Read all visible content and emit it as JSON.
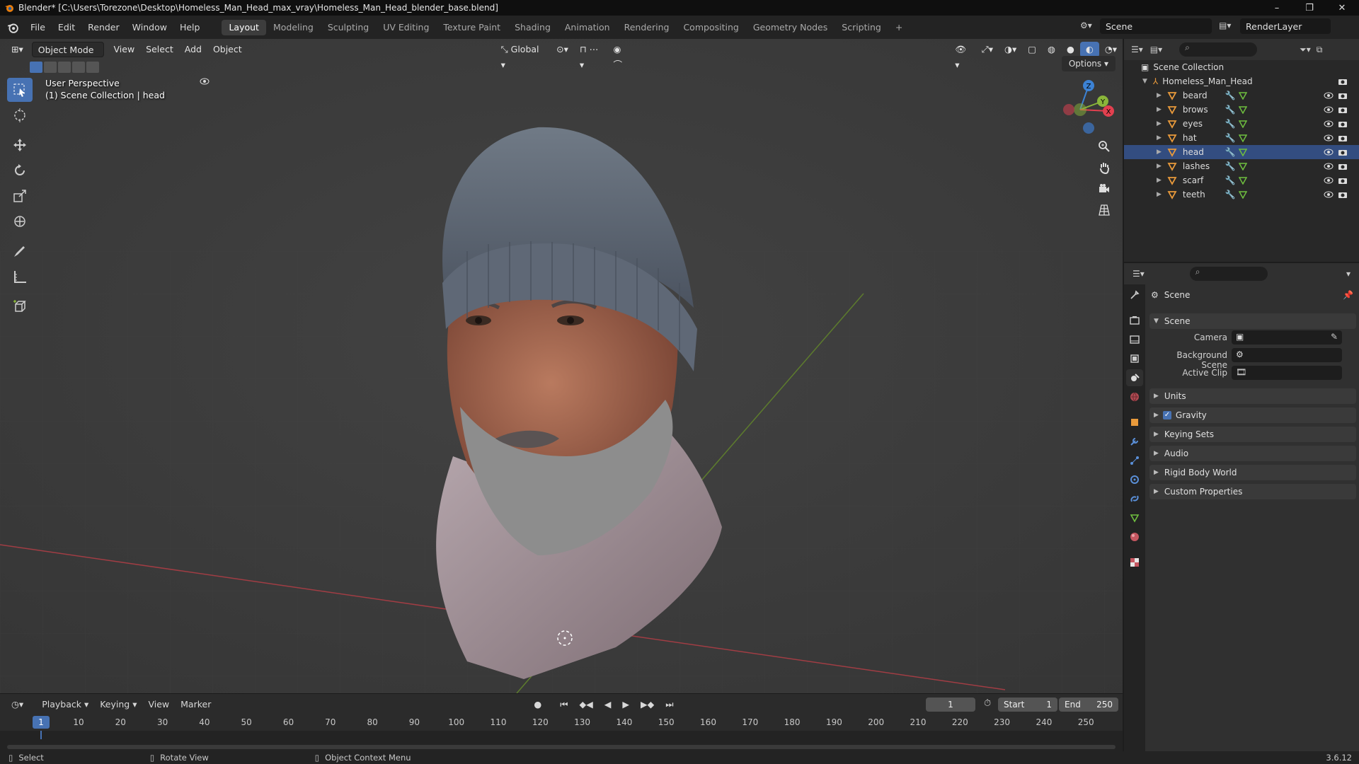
{
  "titlebar": {
    "title": "Blender* [C:\\Users\\Torezone\\Desktop\\Homeless_Man_Head_max_vray\\Homeless_Man_Head_blender_base.blend]",
    "minimize": "–",
    "maximize": "❐",
    "close": "✕"
  },
  "menu": {
    "items": [
      "File",
      "Edit",
      "Render",
      "Window",
      "Help"
    ],
    "workspaces": [
      "Layout",
      "Modeling",
      "Sculpting",
      "UV Editing",
      "Texture Paint",
      "Shading",
      "Animation",
      "Rendering",
      "Compositing",
      "Geometry Nodes",
      "Scripting"
    ],
    "active_workspace": "Layout",
    "add_tab": "+",
    "scene": "Scene",
    "view_layer": "RenderLayer"
  },
  "viewport": {
    "mode": "Object Mode",
    "menus": [
      "View",
      "Select",
      "Add",
      "Object"
    ],
    "orientation": "Global",
    "options": "Options",
    "perspective_label": "User Perspective",
    "collection_label": "(1) Scene Collection | head",
    "axis_labels": {
      "x": "X",
      "y": "Y",
      "z": "Z"
    }
  },
  "timeline": {
    "menus": [
      "Playback",
      "Keying",
      "View",
      "Marker"
    ],
    "current_frame": "1",
    "start_label": "Start",
    "start": "1",
    "end_label": "End",
    "end": "250",
    "ruler": [
      "10",
      "20",
      "30",
      "40",
      "50",
      "60",
      "70",
      "80",
      "90",
      "100",
      "110",
      "120",
      "130",
      "140",
      "150",
      "160",
      "170",
      "180",
      "190",
      "200",
      "210",
      "220",
      "230",
      "240",
      "250"
    ],
    "ruler_current": "1"
  },
  "statusbar": {
    "select": "Select",
    "rotate": "Rotate View",
    "context": "Object Context Menu",
    "version": "3.6.12"
  },
  "outliner": {
    "root": "Scene Collection",
    "collection": "Homeless_Man_Head",
    "objects": [
      "beard",
      "brows",
      "eyes",
      "hat",
      "head",
      "lashes",
      "scarf",
      "teeth"
    ],
    "selected": "head"
  },
  "properties": {
    "context": "Scene",
    "scene_panel": "Scene",
    "camera_label": "Camera",
    "background_scene_label": "Background Scene",
    "active_clip_label": "Active Clip",
    "panels": [
      "Units",
      "Gravity",
      "Keying Sets",
      "Audio",
      "Rigid Body World",
      "Custom Properties"
    ],
    "gravity_checked": true
  },
  "colors": {
    "accent": "#4772b3",
    "x_axis": "#e2404f",
    "y_axis": "#8ab63a",
    "z_axis": "#3c82d4",
    "object_icon": "#e99a3b"
  }
}
